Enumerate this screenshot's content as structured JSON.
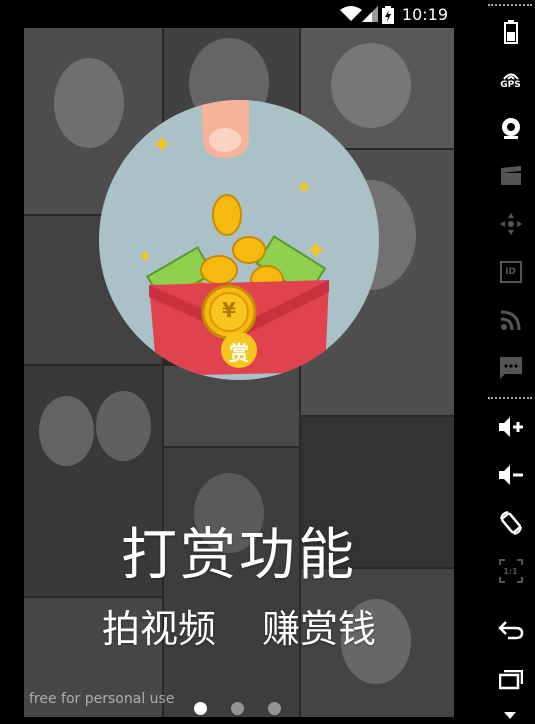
{
  "status_bar": {
    "time": "10:19"
  },
  "onboarding": {
    "title": "打赏功能",
    "subtitle_left": "拍视频",
    "subtitle_right": "赚赏钱",
    "coin_symbol": "¥",
    "envelope_label": "赏",
    "watermark": "free for personal use",
    "page_count": 3,
    "current_page": 1
  },
  "toolbar": {
    "gps_label": "GPS",
    "id_label": "ID",
    "scale_label": "1:1",
    "items": [
      "battery-icon",
      "gps-icon",
      "camera-icon",
      "clapper-icon",
      "dpad-icon",
      "id-icon",
      "cast-icon",
      "message-icon",
      "volume-up-icon",
      "volume-down-icon",
      "rotate-icon",
      "scale-icon",
      "back-icon",
      "recents-icon"
    ]
  },
  "colors": {
    "circle_bg": "#a9c1c7",
    "envelope_red": "#e0424e",
    "coin_gold": "#f5b90f",
    "text_white": "#ffffff"
  }
}
